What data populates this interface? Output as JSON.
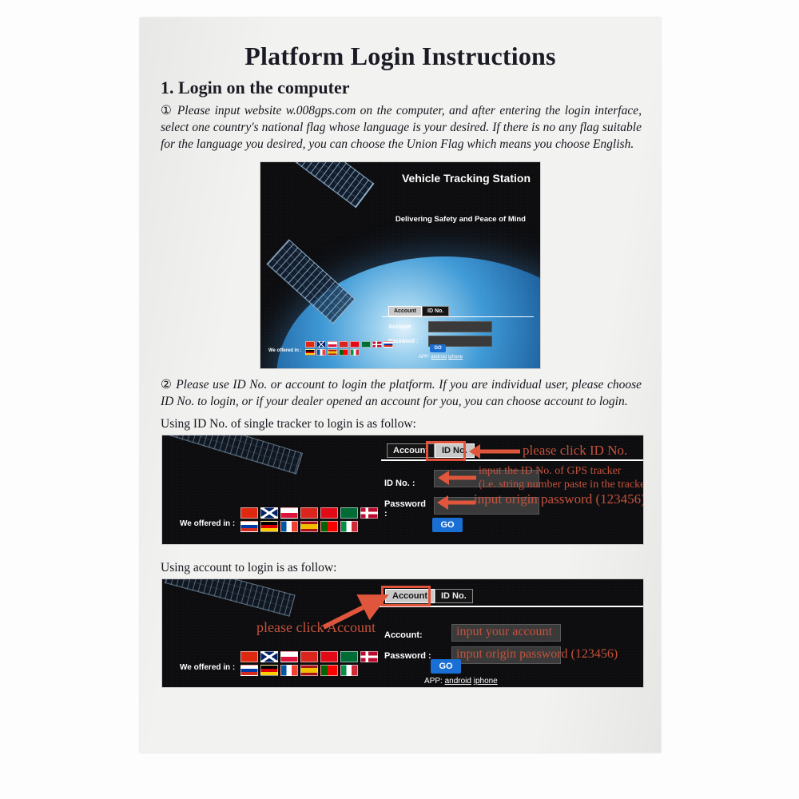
{
  "document": {
    "title": "Platform Login Instructions",
    "section_1_title": "1. Login on the computer",
    "paragraph_1_marker": "①",
    "paragraph_1": "Please input website w.008gps.com on the computer, and after entering the login interface, select one country's national flag whose language is your desired. If there is no any flag suitable for the language you desired, you can choose the Union Flag which means you choose English.",
    "paragraph_2_marker": "②",
    "paragraph_2": "Please use ID No. or account to login the platform. If you are individual user, please choose ID No. to login, or if your dealer opened an account for you, you can choose account to login.",
    "caption_id": "Using ID No. of single tracker to login is as follow:",
    "caption_account": "Using account to login is as follow:"
  },
  "screenshot_1": {
    "headline": "Vehicle Tracking Station",
    "tagline": "Delivering Safety and Peace of Mind",
    "tab_account": "Account",
    "tab_id": "ID No.",
    "label_account": "Account:",
    "label_password": "Password :",
    "go_button": "GO",
    "app_prefix": "APP:",
    "app_android": "android",
    "app_iphone": "iphone",
    "offered_label": "We offered in :"
  },
  "screenshot_2": {
    "tab_account": "Account",
    "tab_id": "ID No.",
    "label_id": "ID No. :",
    "label_password": "Password :",
    "go_button": "GO",
    "offered_label": "We offered in :",
    "anno_click_id": "please click ID No.",
    "anno_input_id_line1": "input the ID No. of GPS tracker",
    "anno_input_id_line2": "(i.e. string number paste in the tracker)",
    "anno_input_password": "input origin password (123456)"
  },
  "screenshot_3": {
    "tab_account": "Account",
    "tab_id": "ID No.",
    "label_account": "Account:",
    "label_password": "Password :",
    "go_button": "GO",
    "app_prefix": "APP:",
    "app_android": "android",
    "app_iphone": "iphone",
    "offered_label": "We offered in :",
    "anno_click_account": "please click Account",
    "anno_input_account": "input your account",
    "anno_input_password": "input origin password (123456)"
  },
  "flags": {
    "row1": [
      "China",
      "United Kingdom",
      "Poland",
      "Vietnam",
      "Turkey",
      "Saudi Arabia",
      "Norway"
    ],
    "row2": [
      "Russia",
      "Germany",
      "France",
      "Spain",
      "Portugal",
      "Italy"
    ]
  },
  "colors": {
    "annotation_red": "#c4523c",
    "highlight_box": "#e0523a",
    "go_blue": "#1a6fd4",
    "paper": "#f2f2f0",
    "ink": "#1b1b25"
  }
}
